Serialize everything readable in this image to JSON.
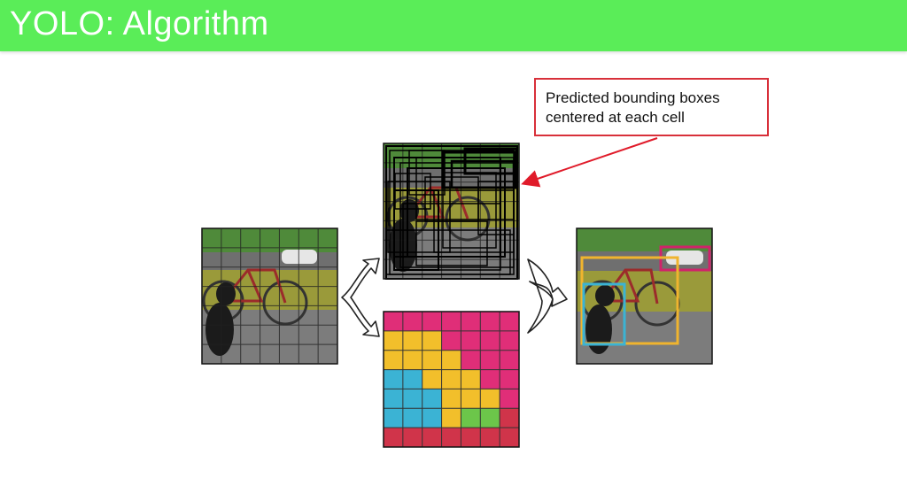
{
  "header": {
    "title": "YOLO: Algorithm",
    "background_color": "#5aed58"
  },
  "callout": {
    "line1": "Predicted bounding boxes",
    "line2": "centered at each cell",
    "border_color": "#d8303a"
  },
  "panels": {
    "input_image": {
      "grid_rows": 7,
      "grid_cols": 7,
      "content": "dog, bicycle, car photo"
    },
    "bounding_boxes_image": {
      "grid_rows": 7,
      "grid_cols": 7,
      "content": "predicted bounding boxes overlaid on photo"
    },
    "class_probability_map": {
      "grid_rows": 7,
      "grid_cols": 7,
      "class_colors": {
        "dog": "#3bb3d4",
        "bicycle": "#f2bf2b",
        "car": "#e02e78",
        "other": "#6cc64a",
        "background": "#d0344a"
      },
      "cells": [
        [
          "car",
          "car",
          "car",
          "car",
          "car",
          "car",
          "car"
        ],
        [
          "bicycle",
          "bicycle",
          "bicycle",
          "car",
          "car",
          "car",
          "car"
        ],
        [
          "bicycle",
          "bicycle",
          "bicycle",
          "bicycle",
          "car",
          "car",
          "car"
        ],
        [
          "dog",
          "dog",
          "bicycle",
          "bicycle",
          "bicycle",
          "car",
          "car"
        ],
        [
          "dog",
          "dog",
          "dog",
          "bicycle",
          "bicycle",
          "bicycle",
          "car"
        ],
        [
          "dog",
          "dog",
          "dog",
          "bicycle",
          "other",
          "other",
          "background"
        ],
        [
          "background",
          "background",
          "background",
          "background",
          "background",
          "background",
          "background"
        ]
      ]
    },
    "final_detections": {
      "detections": [
        {
          "object": "car",
          "color": "#d0236a"
        },
        {
          "object": "bicycle",
          "color": "#f0b42e"
        },
        {
          "object": "dog",
          "color": "#3bb3d4"
        }
      ]
    }
  }
}
